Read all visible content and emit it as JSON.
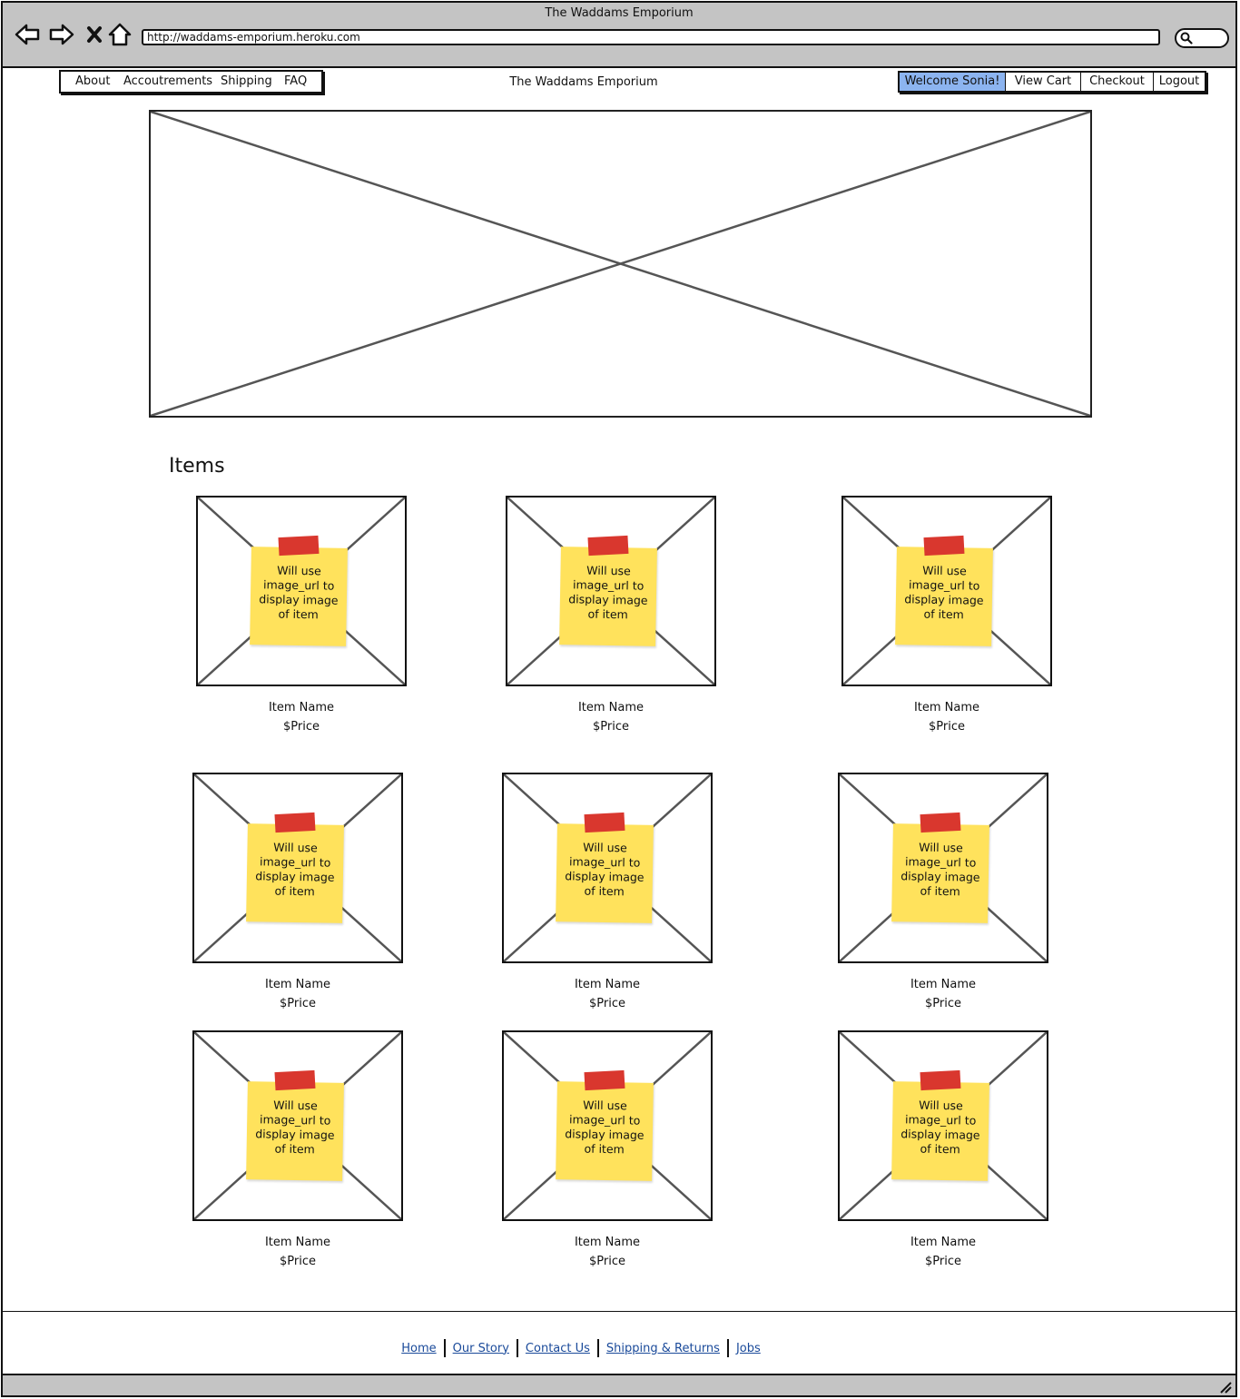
{
  "window": {
    "title": "The Waddams Emporium"
  },
  "browser": {
    "url": "http://waddams-emporium.heroku.com",
    "buttons": [
      "back-icon",
      "forward-icon",
      "stop-icon",
      "home-icon"
    ],
    "search_icon": "search-icon"
  },
  "header": {
    "left_nav": [
      "About",
      "Accoutrements",
      "Shipping",
      "FAQ"
    ],
    "site_name": "The Waddams Emporium",
    "right_nav": [
      "Welcome Sonia!",
      "View Cart",
      "Checkout",
      "Logout"
    ],
    "active_color": "#8cb4f0"
  },
  "hero": {
    "placeholder": "image-placeholder"
  },
  "items_section": {
    "heading": "Items",
    "items": [
      {
        "note": "Will use image_url to display image of item",
        "name": "Item Name",
        "price": "$Price"
      },
      {
        "note": "Will use image_url to display image of item",
        "name": "Item Name",
        "price": "$Price"
      },
      {
        "note": "Will use image_url to display image of item",
        "name": "Item Name",
        "price": "$Price"
      },
      {
        "note": "Will use image_url to display image of item",
        "name": "Item Name",
        "price": "$Price"
      },
      {
        "note": "Will use image_url to display image of item",
        "name": "Item Name",
        "price": "$Price"
      },
      {
        "note": "Will use image_url to display image of item",
        "name": "Item Name",
        "price": "$Price"
      },
      {
        "note": "Will use image_url to display image of item",
        "name": "Item Name",
        "price": "$Price"
      },
      {
        "note": "Will use image_url to display image of item",
        "name": "Item Name",
        "price": "$Price"
      },
      {
        "note": "Will use image_url to display image of item",
        "name": "Item Name",
        "price": "$Price"
      }
    ]
  },
  "footer": {
    "links": [
      "Home",
      "Our Story",
      "Contact Us",
      "Shipping & Returns",
      "Jobs"
    ],
    "link_color": "#1a4a9a"
  },
  "colors": {
    "chrome": "#c4c4c4",
    "sticky_note": "#ffe25c",
    "tape": "#d9372e"
  }
}
